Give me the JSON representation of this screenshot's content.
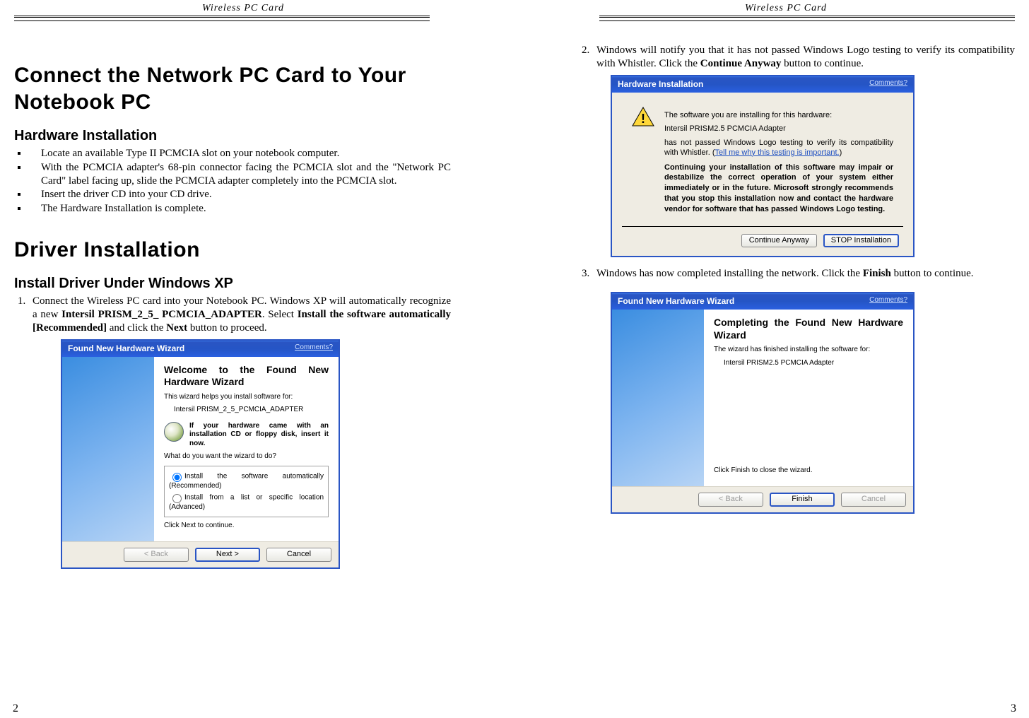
{
  "header": "Wireless  PC  Card",
  "left": {
    "page_num": "2",
    "h1": "Connect the Network PC Card to Your Notebook PC",
    "h2a": "Hardware Installation",
    "bullets": [
      "Locate an available Type II PCMCIA slot on your notebook computer.",
      "With the PCMCIA adapter's 68-pin connector facing the PCMCIA slot and the \"Network PC Card\" label facing up, slide the PCMCIA adapter completely into the PCMCIA slot.",
      "Insert the driver CD into your CD drive.",
      "The Hardware Installation is complete."
    ],
    "h1b": "Driver Installation",
    "h2b": "Install Driver Under Windows XP",
    "step1_pre": "Connect the Wireless PC card into your Notebook PC. Windows XP will automatically recognize a new ",
    "step1_b1": "Intersil PRISM_2_5_ PCMCIA_ADAPTER",
    "step1_mid": ". Select ",
    "step1_b2": "Install the software automatically [Recommended]",
    "step1_mid2": " and click the ",
    "step1_b3": "Next",
    "step1_end": " button to proceed.",
    "dlg1": {
      "title": "Found New Hardware Wizard",
      "comments": "Comments?",
      "heading": "Welcome to the Found New Hardware Wizard",
      "sub": "This wizard helps you install software for:",
      "device": "Intersil PRISM_2_5_PCMCIA_ADAPTER",
      "cd_msg": "If your hardware came with an installation CD or floppy disk, insert it now.",
      "prompt": "What do you want the wizard to do?",
      "opt1": "Install the software automatically (Recommended)",
      "opt2": "Install from a list or specific location (Advanced)",
      "click_next": "Click Next to continue.",
      "back": "< Back",
      "next": "Next >",
      "cancel": "Cancel"
    }
  },
  "right": {
    "page_num": "3",
    "step2_pre": "Windows will notify you that it has not passed Windows Logo testing to verify its compatibility with Whistler. Click the ",
    "step2_b": "Continue Anyway",
    "step2_end": " button to continue.",
    "dlg2": {
      "title": "Hardware Installation",
      "comments": "Comments?",
      "line1": "The software you are installing for this hardware:",
      "line2": "Intersil PRISM2.5 PCMCIA Adapter",
      "line3a": "has not passed Windows Logo testing to verify its compatibility with Whistler. (",
      "line3link": "Tell me why this testing is important.",
      "line3b": ")",
      "bold": "Continuing your installation of this software may impair or destabilize the correct operation of your system either immediately or in the future. Microsoft strongly recommends that you stop this installation now and contact the hardware vendor for software that has passed Windows Logo testing.",
      "btn_continue": "Continue Anyway",
      "btn_stop": "STOP Installation"
    },
    "step3_pre": "Windows has now completed installing the network. Click the ",
    "step3_b": "Finish",
    "step3_end": " button to continue.",
    "dlg3": {
      "title": "Found New Hardware Wizard",
      "comments": "Comments?",
      "heading": "Completing the Found New Hardware Wizard",
      "sub": "The wizard has finished installing the software for:",
      "device": "Intersil PRISM2.5 PCMCIA Adapter",
      "close": "Click Finish to close the wizard.",
      "back": "< Back",
      "finish": "Finish",
      "cancel": "Cancel"
    }
  }
}
